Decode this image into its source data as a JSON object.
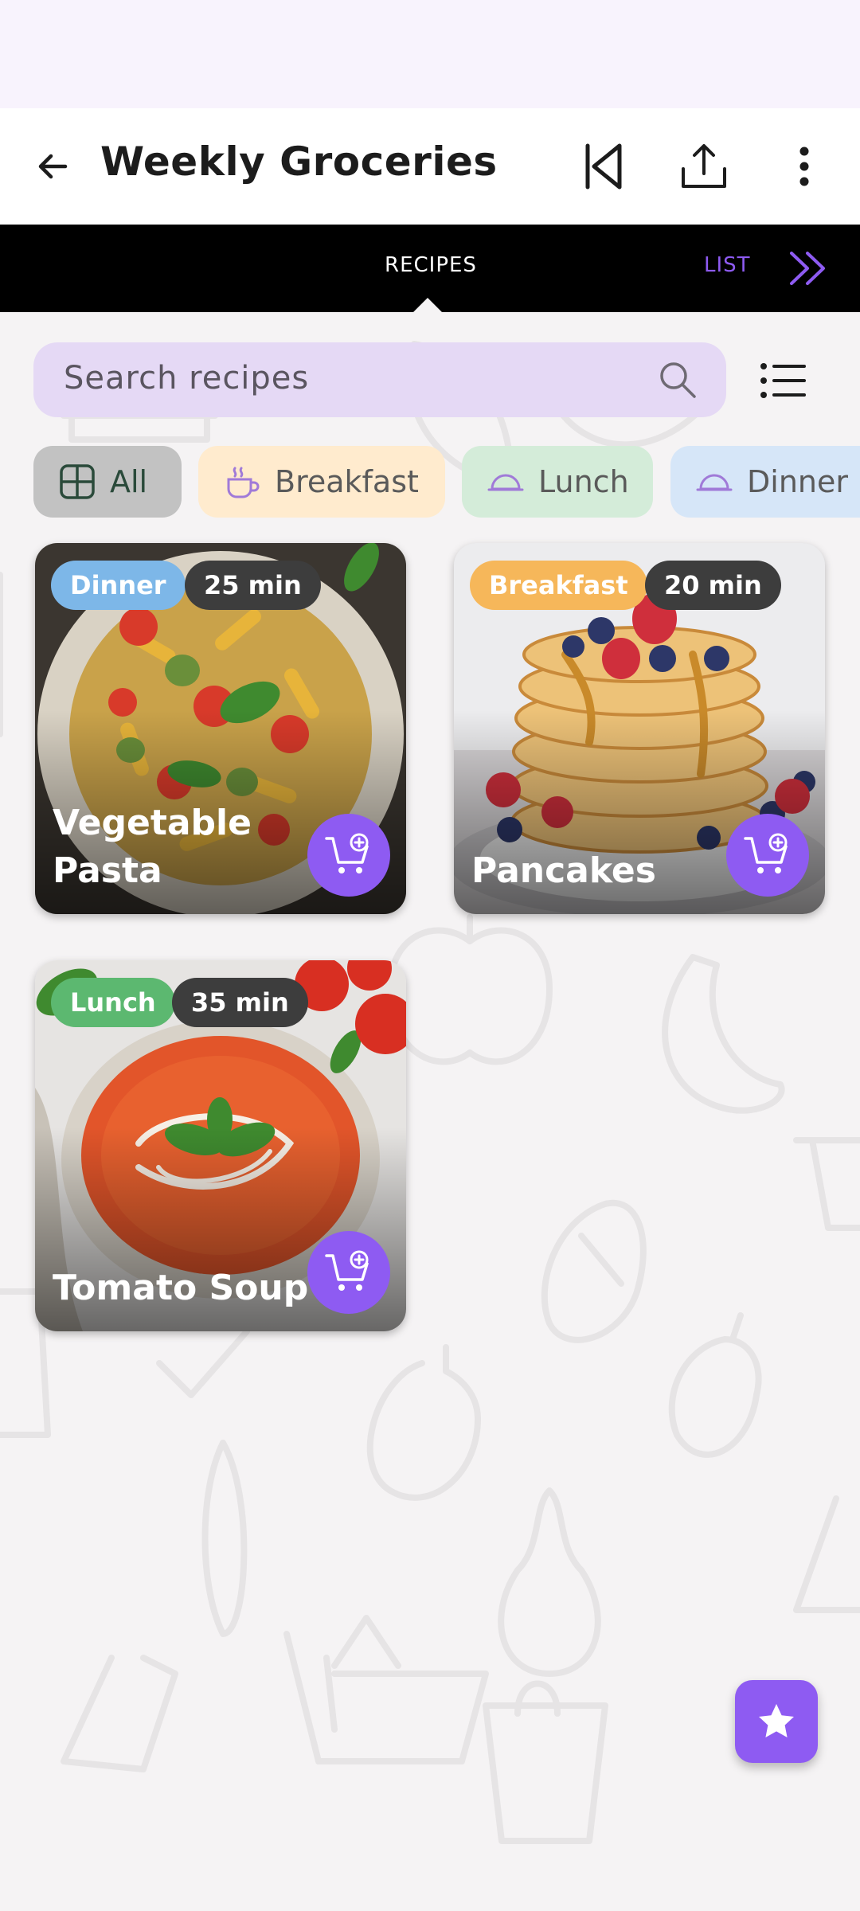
{
  "app_bar": {
    "title": "Weekly Groceries",
    "back_icon": "arrow-left-icon",
    "actions": [
      "skip-previous-icon",
      "share-upload-icon",
      "more-vert-icon"
    ]
  },
  "tabs": {
    "recipes": "RECIPES",
    "list": "LIST",
    "active": "RECIPES"
  },
  "search": {
    "placeholder": "Search recipes"
  },
  "chips": [
    {
      "label": "All",
      "selected": true,
      "color": "#c2c2c2"
    },
    {
      "label": "Breakfast",
      "selected": false,
      "color": "#ffebce"
    },
    {
      "label": "Lunch",
      "selected": false,
      "color": "#d4ecd9"
    },
    {
      "label": "Dinner",
      "selected": false,
      "color": "#d6e6f8"
    }
  ],
  "recipes": [
    {
      "name": "Vegetable Pasta",
      "category": "Dinner",
      "time": "25 min",
      "badge_color": "#7db7e8"
    },
    {
      "name": "Pancakes",
      "category": "Breakfast",
      "time": "20 min",
      "badge_color": "#f6b75a"
    },
    {
      "name": "Tomato Soup",
      "category": "Lunch",
      "time": "35 min",
      "badge_color": "#5cb870"
    }
  ],
  "colors": {
    "accent": "#8e5bf2",
    "time_badge": "#3d3d3d"
  },
  "fab_icon": "star-icon"
}
